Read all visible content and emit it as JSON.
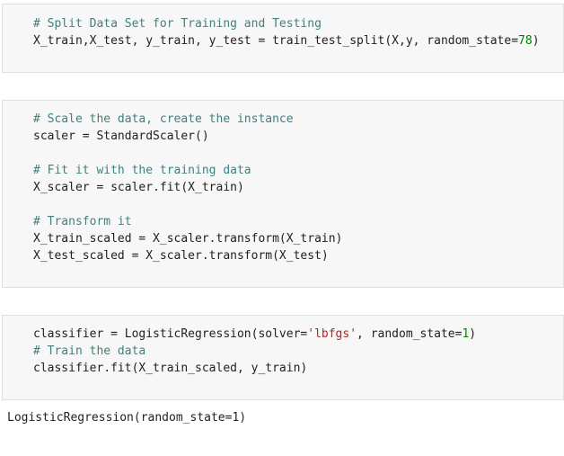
{
  "cells": [
    {
      "lines": [
        {
          "kind": "comment",
          "text": "# Split Data Set for Training and Testing"
        },
        {
          "kind": "code",
          "text": "X_train,X_test, y_train, y_test = train_test_split(X,y, random_state=78)"
        }
      ]
    },
    {
      "lines": [
        {
          "kind": "comment",
          "text": "# Scale the data, create the instance"
        },
        {
          "kind": "code",
          "text": "scaler = StandardScaler()"
        },
        {
          "kind": "blank",
          "text": ""
        },
        {
          "kind": "comment",
          "text": "# Fit it with the training data"
        },
        {
          "kind": "code",
          "text": "X_scaler = scaler.fit(X_train)"
        },
        {
          "kind": "blank",
          "text": ""
        },
        {
          "kind": "comment",
          "text": "# Transform it"
        },
        {
          "kind": "code",
          "text": "X_train_scaled = X_scaler.transform(X_train)"
        },
        {
          "kind": "code",
          "text": "X_test_scaled = X_scaler.transform(X_test)"
        }
      ]
    },
    {
      "lines": [
        {
          "kind": "code",
          "text": "classifier = LogisticRegression(solver='lbfgs', random_state=1)"
        },
        {
          "kind": "comment",
          "text": "# Train the data"
        },
        {
          "kind": "code",
          "text": "classifier.fit(X_train_scaled, y_train)"
        }
      ]
    }
  ],
  "output": {
    "text": "LogisticRegression(random_state=1)"
  },
  "colors": {
    "comment": "#408080",
    "string": "#ba2121",
    "number": "#008000",
    "cell_background": "#f7f7f7"
  }
}
